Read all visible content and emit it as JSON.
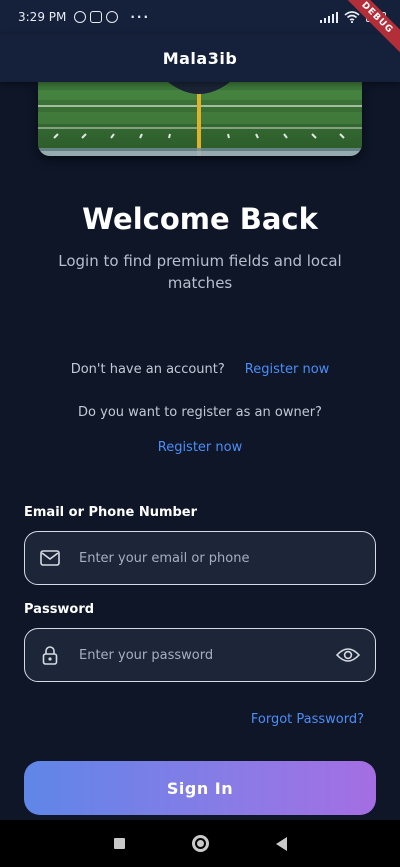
{
  "status_bar": {
    "time": "3:29 PM",
    "dots": "···",
    "debug_badge": "DEBUG"
  },
  "app_bar": {
    "title": "Mala3ib"
  },
  "welcome": {
    "title": "Welcome Back",
    "subtitle": "Login to find premium fields and local matches"
  },
  "register": {
    "prompt": "Don't have an account?",
    "link": "Register now",
    "owner_prompt": "Do you want to register as an owner?",
    "owner_link": "Register now"
  },
  "form": {
    "email_label": "Email or Phone Number",
    "email_placeholder": "Enter your email or phone",
    "password_label": "Password",
    "password_placeholder": "Enter your password",
    "forgot": "Forgot Password?",
    "signin": "Sign In"
  },
  "icons": {
    "email": "mail-icon",
    "password": "lock-icon",
    "visibility": "eye-icon"
  },
  "colors": {
    "background": "#0e1628",
    "link": "#4c8df6",
    "button_start": "#5f86e8",
    "button_end": "#a46ee3"
  }
}
